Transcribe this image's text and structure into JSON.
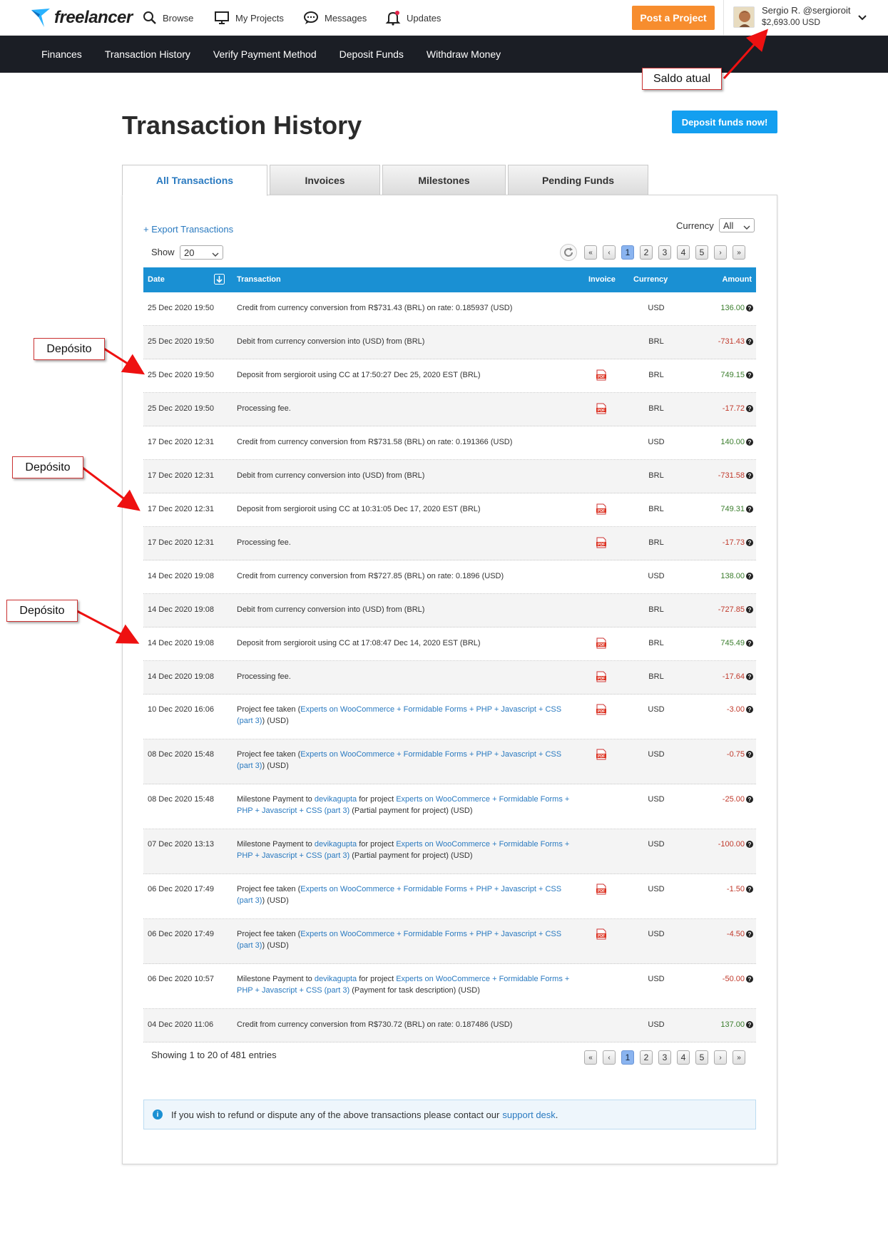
{
  "brand": {
    "name": "freelancer"
  },
  "topnav": {
    "browse": "Browse",
    "my_projects": "My Projects",
    "messages": "Messages",
    "updates": "Updates",
    "post_project": "Post a Project"
  },
  "user": {
    "name": "Sergio R. @sergioroit",
    "balance": "$2,693.00 USD"
  },
  "subnav": [
    "Finances",
    "Transaction History",
    "Verify Payment Method",
    "Deposit Funds",
    "Withdraw Money"
  ],
  "callouts": {
    "balance": "Saldo atual",
    "deposit": "Depósito"
  },
  "page": {
    "title": "Transaction History",
    "deposit_button": "Deposit funds now!"
  },
  "tabs": [
    "All Transactions",
    "Invoices",
    "Milestones",
    "Pending Funds"
  ],
  "controls": {
    "export": "+ Export Transactions",
    "currency_label": "Currency",
    "currency_value": "All",
    "show_label": "Show",
    "show_value": "20"
  },
  "pagination": {
    "first": "«",
    "prev": "‹",
    "pages": [
      "1",
      "2",
      "3",
      "4",
      "5"
    ],
    "current": "1",
    "next": "›",
    "last": "»"
  },
  "table": {
    "headers": {
      "date": "Date",
      "transaction": "Transaction",
      "invoice": "Invoice",
      "currency": "Currency",
      "amount": "Amount"
    },
    "rows": [
      {
        "date": "25 Dec 2020 19:50",
        "desc": [
          {
            "t": "Credit from currency conversion from R$731.43 (BRL) on rate: 0.185937 (USD)"
          }
        ],
        "pdf": false,
        "currency": "USD",
        "amount": "136.00",
        "sign": "pos"
      },
      {
        "date": "25 Dec 2020 19:50",
        "desc": [
          {
            "t": "Debit from currency conversion into (USD) from (BRL)"
          }
        ],
        "pdf": false,
        "currency": "BRL",
        "amount": "-731.43",
        "sign": "neg"
      },
      {
        "date": "25 Dec 2020 19:50",
        "desc": [
          {
            "t": "Deposit from sergioroit using CC at 17:50:27 Dec 25, 2020 EST (BRL)"
          }
        ],
        "pdf": true,
        "currency": "BRL",
        "amount": "749.15",
        "sign": "pos"
      },
      {
        "date": "25 Dec 2020 19:50",
        "desc": [
          {
            "t": "Processing fee."
          }
        ],
        "pdf": true,
        "currency": "BRL",
        "amount": "-17.72",
        "sign": "neg"
      },
      {
        "date": "17 Dec 2020 12:31",
        "desc": [
          {
            "t": "Credit from currency conversion from R$731.58 (BRL) on rate: 0.191366 (USD)"
          }
        ],
        "pdf": false,
        "currency": "USD",
        "amount": "140.00",
        "sign": "pos"
      },
      {
        "date": "17 Dec 2020 12:31",
        "desc": [
          {
            "t": "Debit from currency conversion into (USD) from (BRL)"
          }
        ],
        "pdf": false,
        "currency": "BRL",
        "amount": "-731.58",
        "sign": "neg"
      },
      {
        "date": "17 Dec 2020 12:31",
        "desc": [
          {
            "t": "Deposit from sergioroit using CC at 10:31:05 Dec 17, 2020 EST (BRL)"
          }
        ],
        "pdf": true,
        "currency": "BRL",
        "amount": "749.31",
        "sign": "pos"
      },
      {
        "date": "17 Dec 2020 12:31",
        "desc": [
          {
            "t": "Processing fee."
          }
        ],
        "pdf": true,
        "currency": "BRL",
        "amount": "-17.73",
        "sign": "neg"
      },
      {
        "date": "14 Dec 2020 19:08",
        "desc": [
          {
            "t": "Credit from currency conversion from R$727.85 (BRL) on rate: 0.1896 (USD)"
          }
        ],
        "pdf": false,
        "currency": "USD",
        "amount": "138.00",
        "sign": "pos"
      },
      {
        "date": "14 Dec 2020 19:08",
        "desc": [
          {
            "t": "Debit from currency conversion into (USD) from (BRL)"
          }
        ],
        "pdf": false,
        "currency": "BRL",
        "amount": "-727.85",
        "sign": "neg"
      },
      {
        "date": "14 Dec 2020 19:08",
        "desc": [
          {
            "t": "Deposit from sergioroit using CC at 17:08:47 Dec 14, 2020 EST (BRL)"
          }
        ],
        "pdf": true,
        "currency": "BRL",
        "amount": "745.49",
        "sign": "pos"
      },
      {
        "date": "14 Dec 2020 19:08",
        "desc": [
          {
            "t": "Processing fee."
          }
        ],
        "pdf": true,
        "currency": "BRL",
        "amount": "-17.64",
        "sign": "neg"
      },
      {
        "date": "10 Dec 2020 16:06",
        "desc": [
          {
            "t": "Project fee taken ("
          },
          {
            "t": "Experts on WooCommerce + Formidable Forms + PHP + Javascript + CSS (part 3)",
            "link": true
          },
          {
            "t": ") (USD)"
          }
        ],
        "pdf": true,
        "currency": "USD",
        "amount": "-3.00",
        "sign": "neg"
      },
      {
        "date": "08 Dec 2020 15:48",
        "desc": [
          {
            "t": "Project fee taken ("
          },
          {
            "t": "Experts on WooCommerce + Formidable Forms + PHP + Javascript + CSS (part 3)",
            "link": true
          },
          {
            "t": ") (USD)"
          }
        ],
        "pdf": true,
        "currency": "USD",
        "amount": "-0.75",
        "sign": "neg"
      },
      {
        "date": "08 Dec 2020 15:48",
        "desc": [
          {
            "t": "Milestone Payment to "
          },
          {
            "t": "devikagupta",
            "link": true
          },
          {
            "t": " for project "
          },
          {
            "t": "Experts on WooCommerce + Formidable Forms + PHP + Javascript + CSS (part 3)",
            "link": true
          },
          {
            "t": " (Partial payment for project) (USD)"
          }
        ],
        "pdf": false,
        "currency": "USD",
        "amount": "-25.00",
        "sign": "neg"
      },
      {
        "date": "07 Dec 2020 13:13",
        "desc": [
          {
            "t": "Milestone Payment to "
          },
          {
            "t": "devikagupta",
            "link": true
          },
          {
            "t": " for project "
          },
          {
            "t": "Experts on WooCommerce + Formidable Forms + PHP + Javascript + CSS (part 3)",
            "link": true
          },
          {
            "t": " (Partial payment for project) (USD)"
          }
        ],
        "pdf": false,
        "currency": "USD",
        "amount": "-100.00",
        "sign": "neg"
      },
      {
        "date": "06 Dec 2020 17:49",
        "desc": [
          {
            "t": "Project fee taken ("
          },
          {
            "t": "Experts on WooCommerce + Formidable Forms + PHP + Javascript + CSS (part 3)",
            "link": true
          },
          {
            "t": ") (USD)"
          }
        ],
        "pdf": true,
        "currency": "USD",
        "amount": "-1.50",
        "sign": "neg"
      },
      {
        "date": "06 Dec 2020 17:49",
        "desc": [
          {
            "t": "Project fee taken ("
          },
          {
            "t": "Experts on WooCommerce + Formidable Forms + PHP + Javascript + CSS (part 3)",
            "link": true
          },
          {
            "t": ") (USD)"
          }
        ],
        "pdf": true,
        "currency": "USD",
        "amount": "-4.50",
        "sign": "neg"
      },
      {
        "date": "06 Dec 2020 10:57",
        "desc": [
          {
            "t": "Milestone Payment to "
          },
          {
            "t": "devikagupta",
            "link": true
          },
          {
            "t": " for project "
          },
          {
            "t": "Experts on WooCommerce + Formidable Forms + PHP + Javascript + CSS (part 3)",
            "link": true
          },
          {
            "t": " (Payment for task description) (USD)"
          }
        ],
        "pdf": false,
        "currency": "USD",
        "amount": "-50.00",
        "sign": "neg"
      },
      {
        "date": "04 Dec 2020 11:06",
        "desc": [
          {
            "t": "Credit from currency conversion from R$730.72 (BRL) on rate: 0.187486 (USD)"
          }
        ],
        "pdf": false,
        "currency": "USD",
        "amount": "137.00",
        "sign": "pos"
      }
    ]
  },
  "footer": {
    "showing": "Showing 1 to 20 of 481 entries",
    "note_text": "If you wish to refund or dispute any of the above transactions please contact our ",
    "note_link": "support desk",
    "note_end": "."
  }
}
